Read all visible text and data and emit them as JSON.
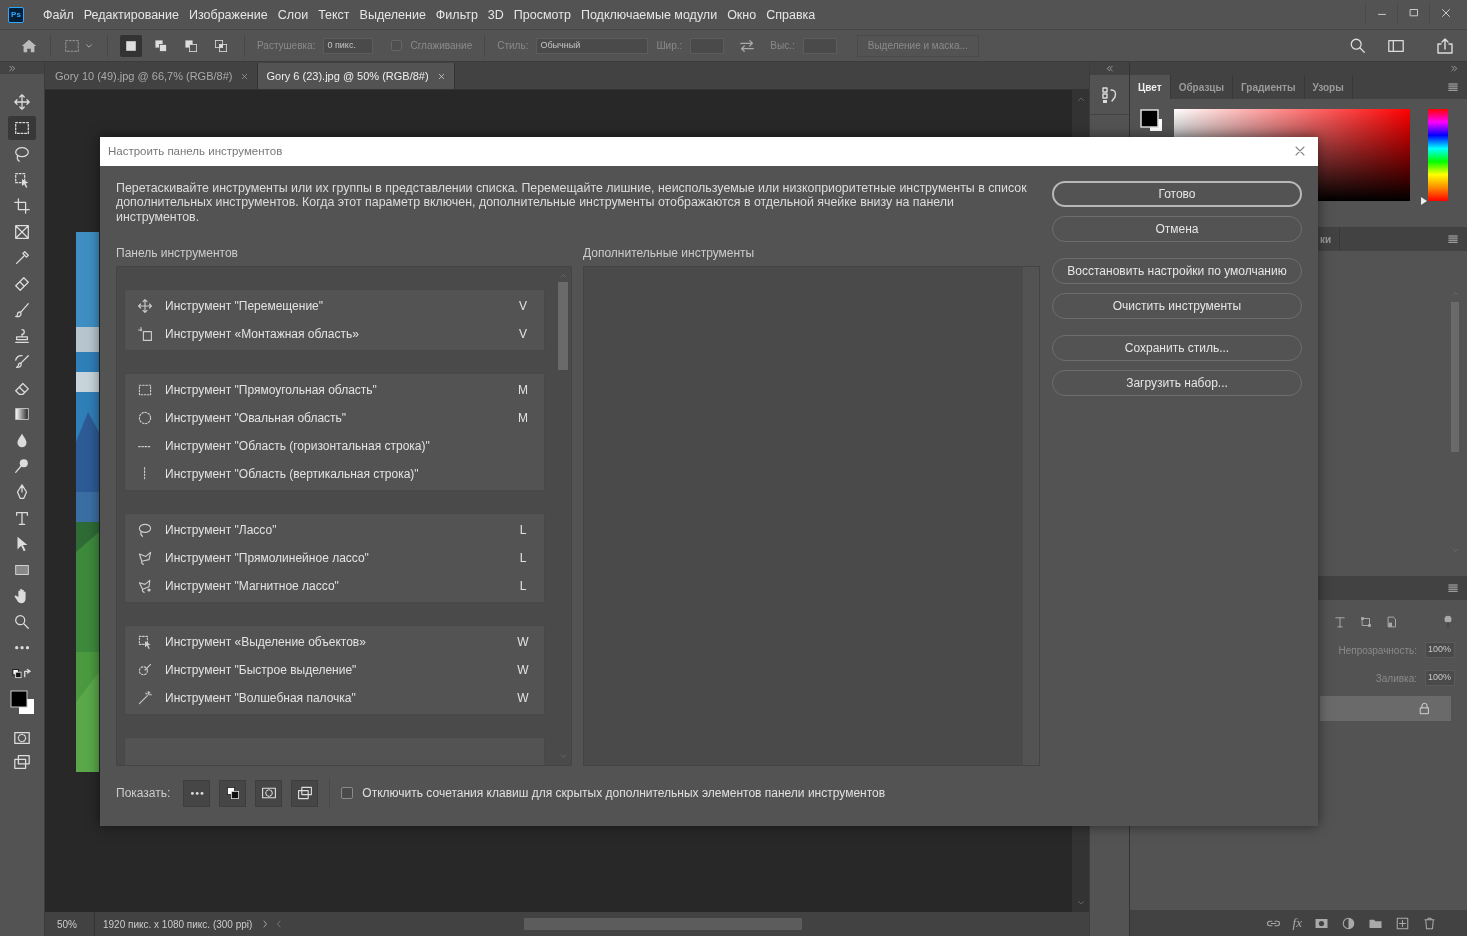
{
  "menu_bar": {
    "logo": "Ps",
    "items": [
      "Файл",
      "Редактирование",
      "Изображение",
      "Слои",
      "Текст",
      "Выделение",
      "Фильтр",
      "3D",
      "Просмотр",
      "Подключаемые модули",
      "Окно",
      "Справка"
    ]
  },
  "options_bar": {
    "modes": [
      {
        "selected": true
      },
      {
        "selected": false
      },
      {
        "selected": false
      },
      {
        "selected": false
      }
    ],
    "feather_label": "Растушевка:",
    "feather_value": "0 пикс.",
    "antialias": {
      "label": "Сглаживание",
      "checked": false
    },
    "style_label": "Стиль:",
    "style_value": "Обычный",
    "width_label": "Шир.:",
    "height_label": "Выс.:",
    "mask_button": "Выделение и маска..."
  },
  "document_tabs": [
    {
      "label": "Gory 10 (49).jpg @ 66,7% (RGB/8#)",
      "selected": false
    },
    {
      "label": "Gory 6 (23).jpg @ 50% (RGB/8#)",
      "selected": true
    }
  ],
  "toolbar": {
    "tools": [
      {
        "kind": "move",
        "selected": false
      },
      {
        "kind": "marquee",
        "selected": true
      },
      {
        "kind": "lasso",
        "selected": false
      },
      {
        "kind": "object-select",
        "selected": false
      },
      {
        "kind": "crop",
        "selected": false
      },
      {
        "kind": "frame",
        "selected": false
      },
      {
        "kind": "eyedropper",
        "selected": false
      },
      {
        "kind": "healing",
        "selected": false
      },
      {
        "kind": "brush",
        "selected": false
      },
      {
        "kind": "stamp",
        "selected": false
      },
      {
        "kind": "history-brush",
        "selected": false
      },
      {
        "kind": "eraser",
        "selected": false
      },
      {
        "kind": "gradient",
        "selected": false
      },
      {
        "kind": "drop",
        "selected": false
      },
      {
        "kind": "dodge",
        "selected": false
      },
      {
        "kind": "pen",
        "selected": false
      },
      {
        "kind": "type",
        "selected": false
      },
      {
        "kind": "path-select",
        "selected": false
      },
      {
        "kind": "rectangle",
        "selected": false
      },
      {
        "kind": "hand",
        "selected": false
      },
      {
        "kind": "zoom",
        "selected": false
      },
      {
        "kind": "more",
        "selected": false
      }
    ]
  },
  "color_panel": {
    "hue_slider": {
      "level": 0
    },
    "tabs": [
      {
        "label": "Цвет",
        "selected": true
      },
      {
        "label": "Образцы",
        "selected": false
      },
      {
        "label": "Градиенты",
        "selected": false
      },
      {
        "label": "Узоры",
        "selected": false
      }
    ]
  },
  "second_panel": {
    "tabs": [
      "ки"
    ]
  },
  "layers_panel": {
    "opacity_label": "Непрозрачность:",
    "opacity_value": "100%",
    "fill_label": "Заливка:",
    "fill_value": "100%",
    "footer_fx": "fx"
  },
  "status_bar": {
    "zoom": "50%",
    "doc_info": "1920 пикс. x 1080 пикс. (300 ppi)"
  },
  "dialog": {
    "title": "Настроить панель инструментов",
    "description": "Перетаскивайте инструменты или их группы в представлении списка. Перемещайте лишние, неиспользуемые или низкоприоритетные инструменты в список дополнительных инструментов. Когда этот параметр включен, дополнительные инструменты отображаются в отдельной ячейке внизу на панели инструментов.",
    "toolbar_heading": "Панель инструментов",
    "extra_heading": "Дополнительные инструменты",
    "groups": [
      {
        "tools": [
          {
            "kind": "move",
            "name": "Инструмент \"Перемещение\"",
            "shortcut": "V"
          },
          {
            "kind": "artboard",
            "name": "Инструмент «Монтажная область»",
            "shortcut": "V"
          }
        ]
      },
      {
        "tools": [
          {
            "kind": "marquee",
            "name": "Инструмент \"Прямоугольная область\"",
            "shortcut": "M"
          },
          {
            "kind": "ellipse",
            "name": "Инструмент \"Овальная область\"",
            "shortcut": "M"
          },
          {
            "kind": "row",
            "name": "Инструмент \"Область (горизонтальная строка)\""
          },
          {
            "kind": "column",
            "name": "Инструмент \"Область (вертикальная строка)\""
          }
        ]
      },
      {
        "tools": [
          {
            "kind": "lasso",
            "name": "Инструмент \"Лассо\"",
            "shortcut": "L"
          },
          {
            "kind": "polygon-lasso",
            "name": "Инструмент \"Прямолинейное лассо\"",
            "shortcut": "L"
          },
          {
            "kind": "magnetic-lasso",
            "name": "Инструмент \"Магнитное лассо\"",
            "shortcut": "L"
          }
        ]
      },
      {
        "tools": [
          {
            "kind": "object-select",
            "name": "Инструмент «Выделение объектов»",
            "shortcut": "W"
          },
          {
            "kind": "quick-select",
            "name": "Инструмент \"Быстрое выделение\"",
            "shortcut": "W"
          },
          {
            "kind": "wand",
            "name": "Инструмент \"Волшебная палочка\"",
            "shortcut": "W"
          }
        ]
      }
    ],
    "buttons": [
      {
        "label": "Готово",
        "default": true
      },
      {
        "label": "Отмена",
        "default": false
      },
      {
        "label": "Восстановить настройки по умолчанию",
        "default": false
      },
      {
        "label": "Очистить инструменты",
        "default": false
      },
      {
        "label": "Сохранить стиль...",
        "default": false
      },
      {
        "label": "Загрузить набор...",
        "default": false
      }
    ],
    "show_label": "Показать:",
    "show_buttons": [
      {
        "kind": "more"
      },
      {
        "kind": "swatches"
      },
      {
        "kind": "quick-mask"
      },
      {
        "kind": "screen-mode"
      }
    ],
    "checkbox": {
      "label": "Отключить сочетания клавиш для скрытых дополнительных элементов панели инструментов",
      "checked": false
    }
  }
}
